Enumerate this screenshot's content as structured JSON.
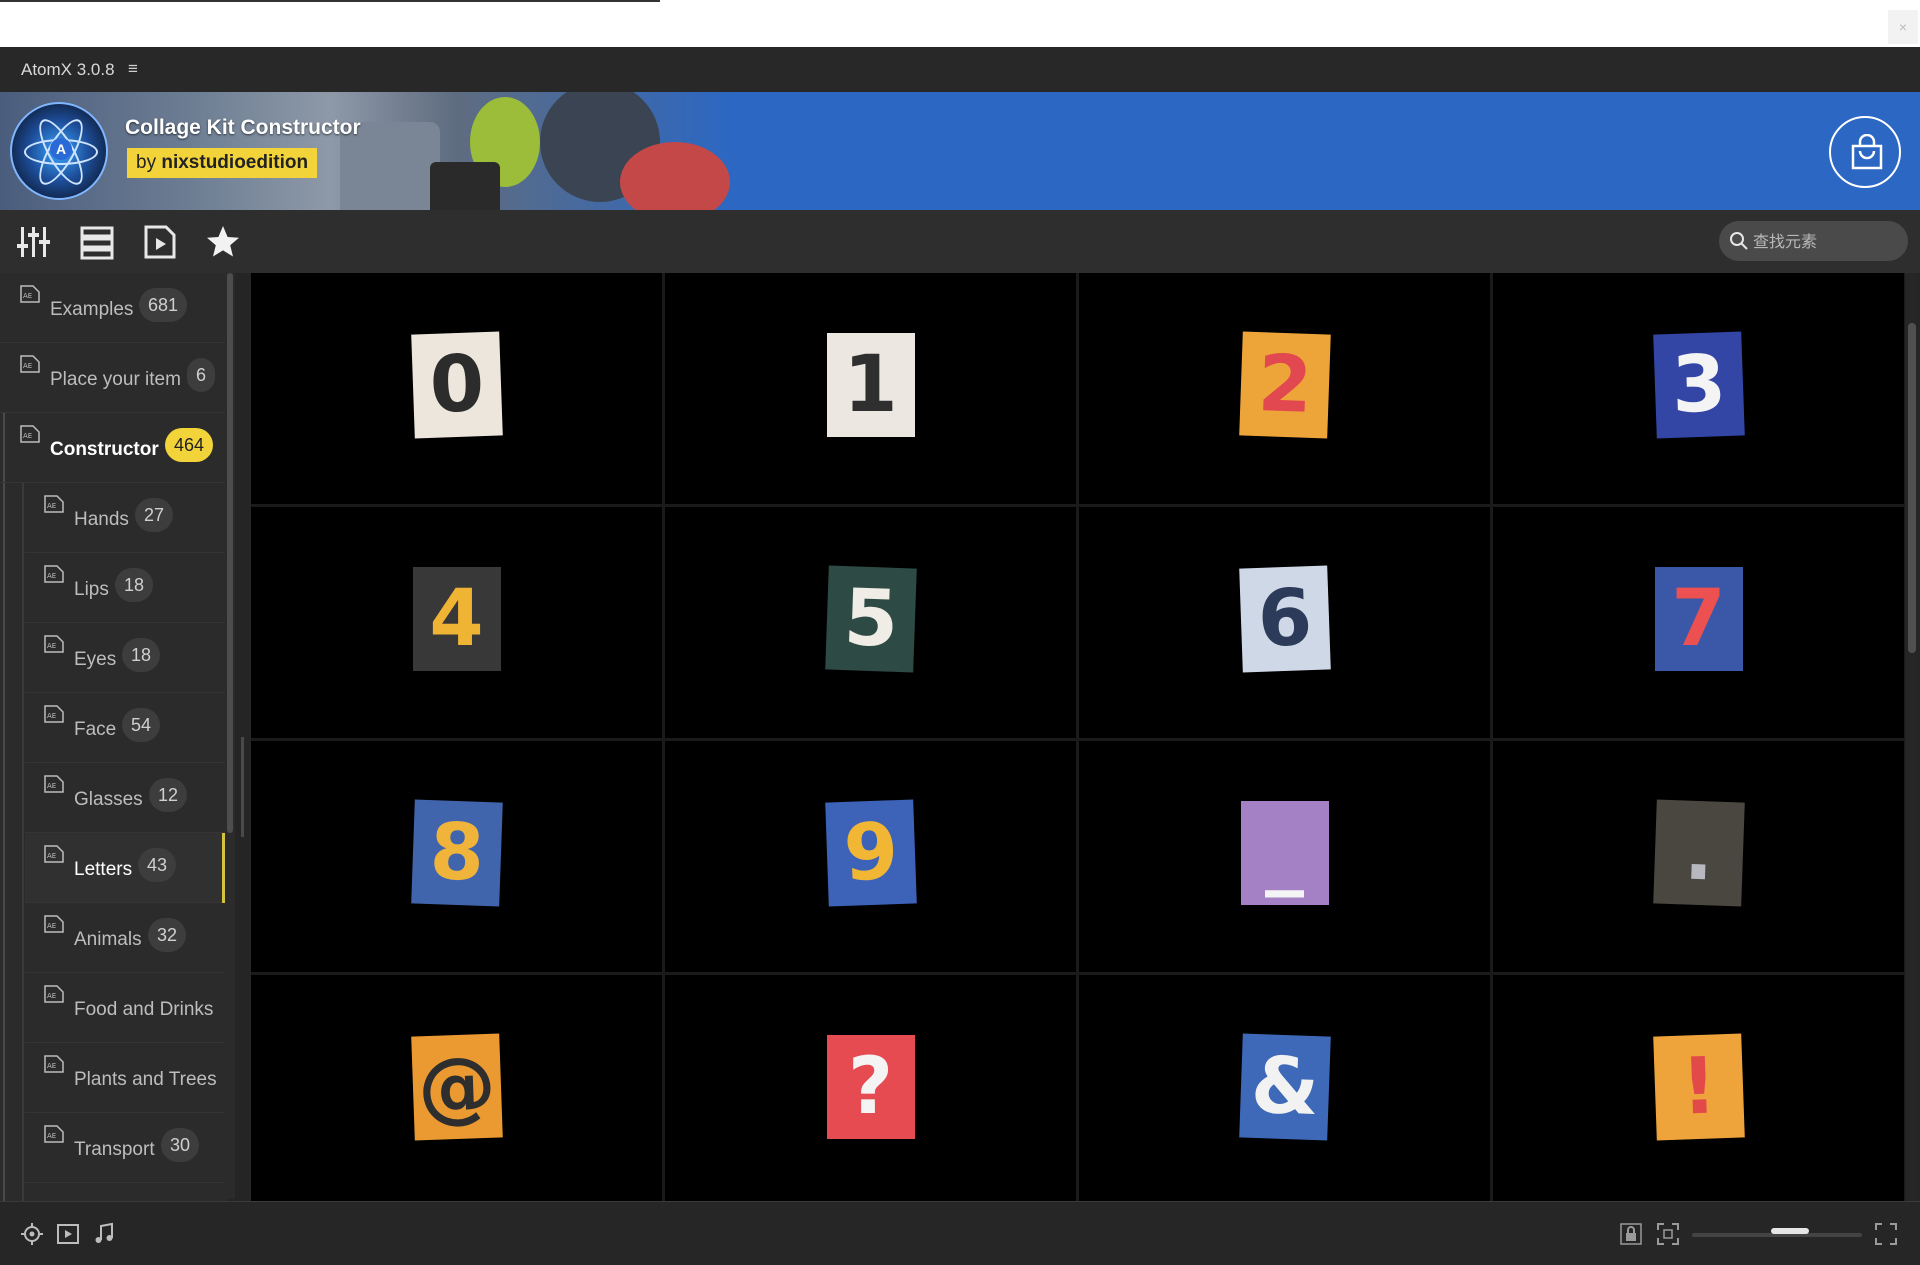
{
  "window": {
    "close_label": "×"
  },
  "app": {
    "title": "AtomX 3.0.8",
    "menu_glyph": "≡"
  },
  "banner": {
    "pack_title": "Collage Kit Constructor",
    "author_prefix": "by",
    "author_name": "nixstudioedition",
    "logo_letter": "A"
  },
  "toolbar": {
    "buttons": [
      "adjust-icon",
      "list-view-icon",
      "media-file-icon",
      "star-icon"
    ],
    "search": {
      "placeholder": "查找元素",
      "value": ""
    }
  },
  "sidebar": {
    "items": [
      {
        "label": "Examples",
        "count": "681",
        "level": 0
      },
      {
        "label": "Place your item",
        "count": "6",
        "level": 0
      },
      {
        "label": "Constructor",
        "count": "464",
        "level": 0,
        "active": true
      },
      {
        "label": "Hands",
        "count": "27",
        "level": 1
      },
      {
        "label": "Lips",
        "count": "18",
        "level": 1
      },
      {
        "label": "Eyes",
        "count": "18",
        "level": 1
      },
      {
        "label": "Face",
        "count": "54",
        "level": 1
      },
      {
        "label": "Glasses",
        "count": "12",
        "level": 1
      },
      {
        "label": "Letters",
        "count": "43",
        "level": 1,
        "selected": true
      },
      {
        "label": "Animals",
        "count": "32",
        "level": 1
      },
      {
        "label": "Food and Drinks",
        "count": "",
        "level": 1
      },
      {
        "label": "Plants and Trees",
        "count": "",
        "level": 1
      },
      {
        "label": "Transport",
        "count": "30",
        "level": 1
      }
    ]
  },
  "grid": {
    "items": [
      {
        "glyph": "0",
        "bg": "#ece6dc",
        "fg": "#2c2c2c"
      },
      {
        "glyph": "1",
        "bg": "#ece8e1",
        "fg": "#2f2f2f"
      },
      {
        "glyph": "2",
        "bg": "#eda53a",
        "fg": "#e2484f"
      },
      {
        "glyph": "3",
        "bg": "#3446a5",
        "fg": "#f4f4f4"
      },
      {
        "glyph": "4",
        "bg": "#383838",
        "fg": "#f0b435"
      },
      {
        "glyph": "5",
        "bg": "#2e4a44",
        "fg": "#f0ece6"
      },
      {
        "glyph": "6",
        "bg": "#cfd8e6",
        "fg": "#2d3b5a"
      },
      {
        "glyph": "7",
        "bg": "#3a57a8",
        "fg": "#ec5050"
      },
      {
        "glyph": "8",
        "bg": "#4165ac",
        "fg": "#f0b43a"
      },
      {
        "glyph": "9",
        "bg": "#3c63b8",
        "fg": "#f2b635"
      },
      {
        "glyph": "_",
        "bg": "#a480c4",
        "fg": "#f4f4f4"
      },
      {
        "glyph": ".",
        "bg": "#4a4640",
        "fg": "#b8b8c0"
      },
      {
        "glyph": "@",
        "bg": "#eb9a32",
        "fg": "#2e2e2e"
      },
      {
        "glyph": "?",
        "bg": "#e64b52",
        "fg": "#f4f4f4"
      },
      {
        "glyph": "&",
        "bg": "#3d69b8",
        "fg": "#f2f2f2"
      },
      {
        "glyph": "!",
        "bg": "#eea43a",
        "fg": "#e24a4a"
      }
    ]
  },
  "bottombar": {
    "icons": [
      "locate-icon",
      "play-icon",
      "music-icon",
      "lock-icon",
      "fit-icon",
      "fullscreen-icon"
    ]
  },
  "colors": {
    "accent": "#f2d43a",
    "banner_blue": "#2b67c3"
  }
}
